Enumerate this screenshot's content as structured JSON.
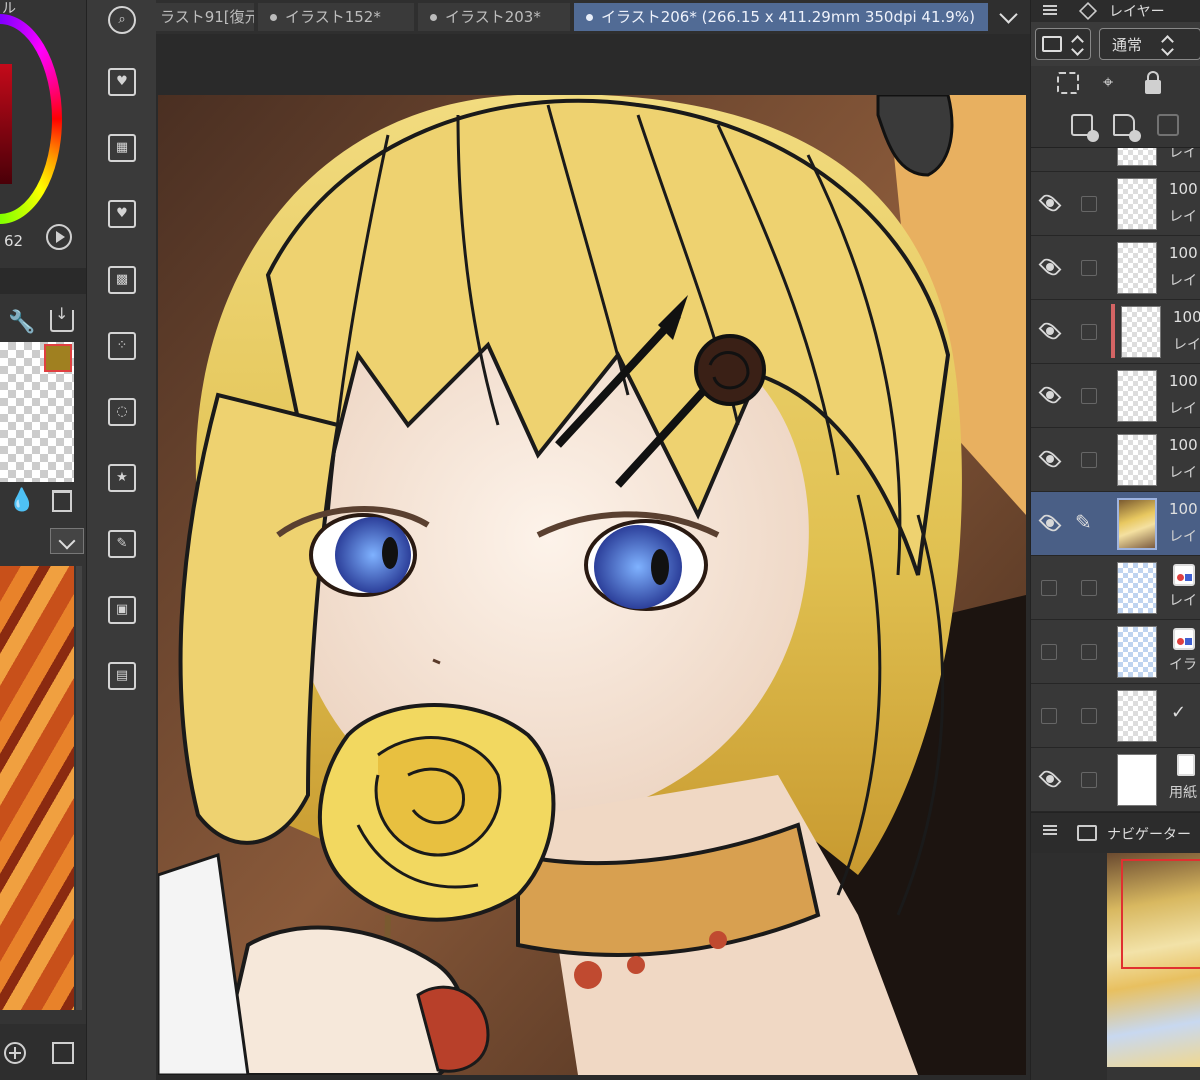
{
  "color_panel": {
    "title": "ル",
    "value": "62"
  },
  "tabs": [
    {
      "label": "ラスト91[復元",
      "active": false,
      "dot": false
    },
    {
      "label": "イラスト152*",
      "active": false,
      "dot": true
    },
    {
      "label": "イラスト203*",
      "active": false,
      "dot": true
    },
    {
      "label": "イラスト206* (266.15 x 411.29mm 350dpi 41.9%)",
      "active": true,
      "dot": true
    }
  ],
  "layer_panel": {
    "title": "レイヤー",
    "blend_mode": "通常",
    "layers": [
      {
        "opacity": "",
        "name": "レイ",
        "visible": false,
        "thumb": "checker"
      },
      {
        "opacity": "100",
        "name": "レイ",
        "visible": true,
        "thumb": "checker"
      },
      {
        "opacity": "100",
        "name": "レイ",
        "visible": true,
        "thumb": "checker"
      },
      {
        "opacity": "100",
        "name": "レイ",
        "visible": true,
        "thumb": "checker"
      },
      {
        "opacity": "100",
        "name": "レイ",
        "visible": true,
        "thumb": "checker"
      },
      {
        "opacity": "100",
        "name": "レイ",
        "visible": true,
        "thumb": "checker"
      },
      {
        "opacity": "100",
        "name": "レイ",
        "visible": true,
        "thumb": "art"
      },
      {
        "opacity": "",
        "name": "レイ",
        "visible": false,
        "thumb": "blue"
      },
      {
        "opacity": "",
        "name": "イラ",
        "visible": false,
        "thumb": "blue"
      },
      {
        "opacity": "",
        "name": "",
        "visible": false,
        "thumb": "checker"
      },
      {
        "opacity": "",
        "name": "用紙",
        "visible": true,
        "thumb": "white"
      }
    ]
  },
  "navigator": {
    "title": "ナビゲーター"
  },
  "colors": {
    "active_tab": "#516b95",
    "selected_layer": "#4a5f86",
    "clip_indicator": "#d46464",
    "swatch": "#a08020"
  }
}
